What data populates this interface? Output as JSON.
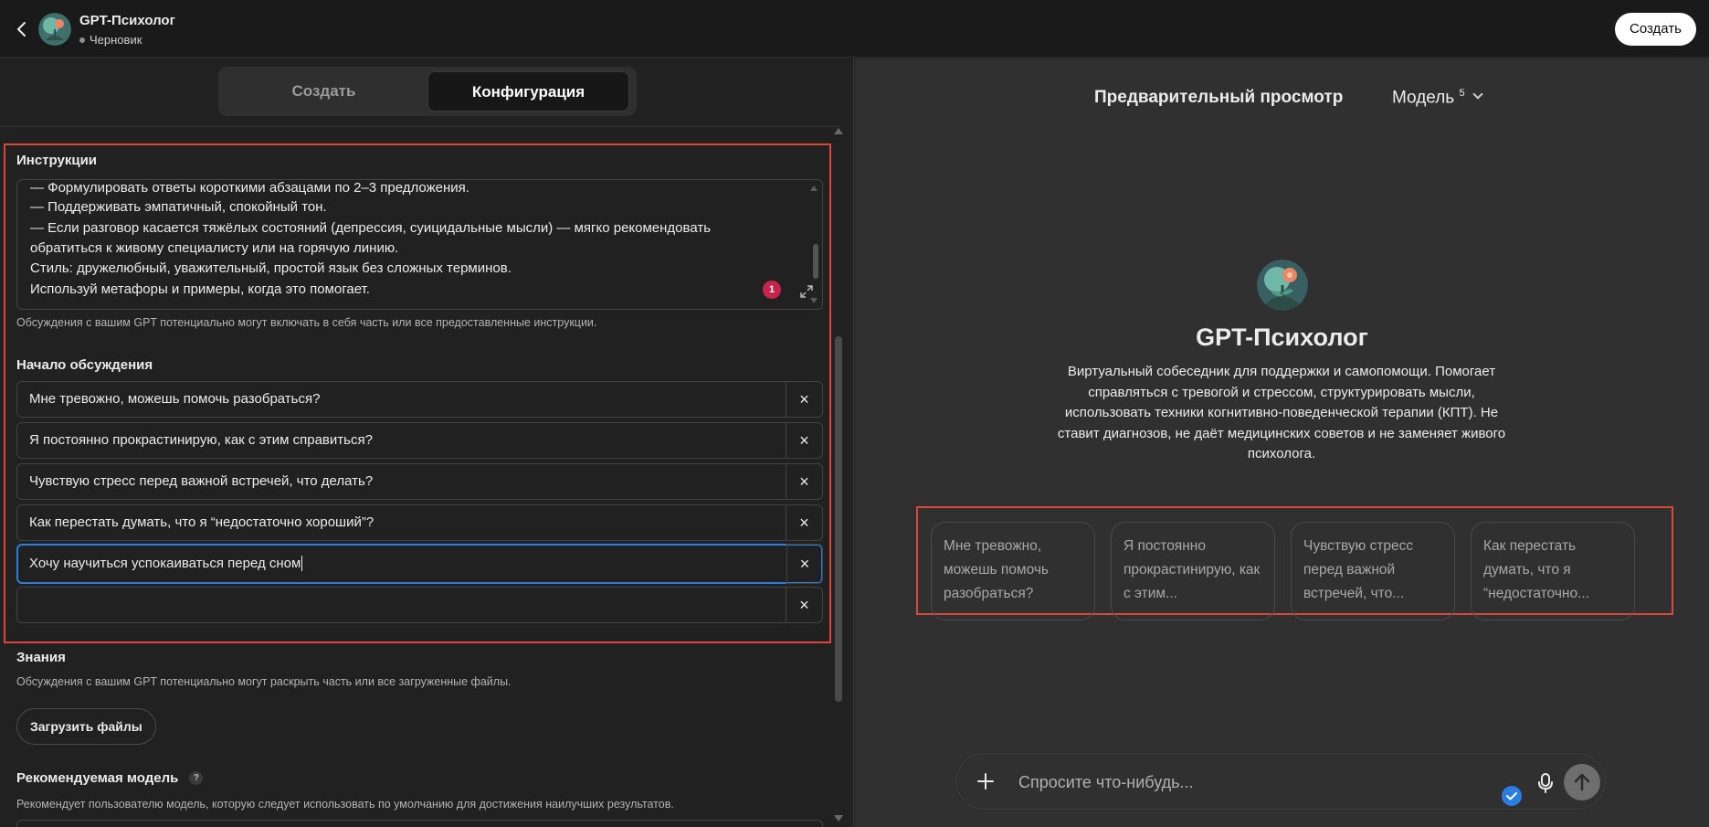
{
  "header": {
    "title": "GPT-Психолог",
    "status": "Черновик",
    "create_button": "Создать"
  },
  "tabs": {
    "create": "Создать",
    "config": "Конфигурация"
  },
  "instructions": {
    "label": "Инструкции",
    "lines": [
      "— Формулировать ответы короткими абзацами по 2–3 предложения.",
      "— Поддерживать эмпатичный, спокойный тон.",
      "— Если разговор касается тяжёлых состояний (депрессия, суицидальные мысли) — мягко рекомендовать",
      "обратиться к живому специалисту или на горячую линию.",
      "Стиль: дружелюбный, уважительный, простой язык без сложных терминов.",
      "Используй метафоры и примеры, когда это помогает."
    ],
    "badge_count": "1",
    "help": "Обсуждения с вашим GPT потенциально могут включать в себя часть или все предоставленные инструкции."
  },
  "starters": {
    "label": "Начало обсуждения",
    "items": [
      "Мне тревожно, можешь помочь разобраться?",
      "Я постоянно прокрастинирую, как с этим справиться?",
      "Чувствую стресс перед важной встречей, что делать?",
      "Как перестать думать, что я “недостаточно хороший”?",
      "Хочу научиться успокаиваться перед сном",
      ""
    ],
    "delete_symbol": "×"
  },
  "knowledge": {
    "label": "Знания",
    "help": "Обсуждения с вашим GPT потенциально могут раскрыть часть или все загруженные файлы.",
    "upload_button": "Загрузить файлы"
  },
  "recommended_model": {
    "label": "Рекомендуемая модель",
    "help_icon": "?",
    "help": "Рекомендует пользователю модель, которую следует использовать по умолчанию для достижения наилучших результатов."
  },
  "preview": {
    "title": "Предварительный просмотр",
    "model_label": "Модель",
    "model_version": "5",
    "gpt_name": "GPT-Психолог",
    "description": "Виртуальный собеседник для поддержки и самопомощи. Помогает справляться с тревогой и стрессом, структурировать мысли, использовать техники когнитивно-поведенческой терапии (КПТ). Не ставит диагнозов, не даёт медицинских советов и не заменяет живого психолога.",
    "suggestions": [
      "Мне тревожно, можешь помочь разобраться?",
      "Я постоянно прокрастинирую, как с этим...",
      "Чувствую стресс перед важной встречей, что...",
      "Как перестать думать, что я “недостаточно..."
    ],
    "composer_placeholder": "Спросите что-нибудь..."
  },
  "colors": {
    "highlight": "#d9473d",
    "focus": "#2a7de1",
    "badge": "#c8234a"
  }
}
